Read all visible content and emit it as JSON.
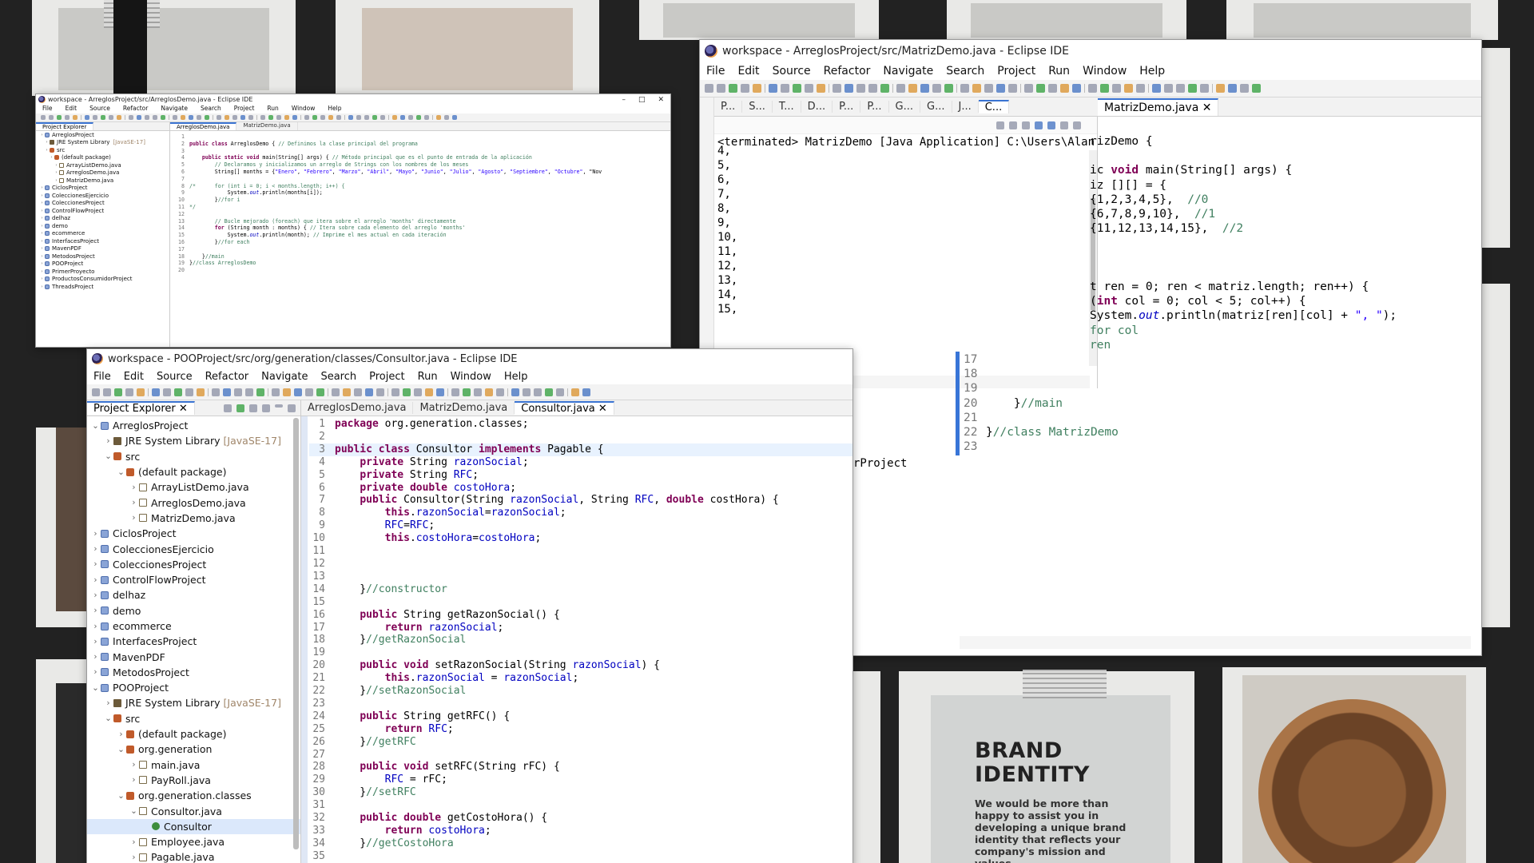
{
  "bg": {
    "brand_title_1": "BRAND",
    "brand_title_2": "IDENTITY",
    "brand_text": "We would be more than happy to assist you in developing a unique brand identity that reflects your company's mission and values."
  },
  "win_small": {
    "title": "workspace - ArreglosProject/src/ArreglosDemo.java - Eclipse IDE",
    "menu": [
      "File",
      "Edit",
      "Source",
      "Refactor",
      "Navigate",
      "Search",
      "Project",
      "Run",
      "Window",
      "Help"
    ],
    "explorer_tab": "Project Explorer",
    "editor_tabs": [
      "ArreglosDemo.java",
      "MatrizDemo.java"
    ],
    "tree": [
      {
        "label": "ArreglosProject",
        "level": 0,
        "icon": "proj"
      },
      {
        "label": "JRE System Library",
        "extra": "[JavaSE-17]",
        "level": 1,
        "icon": "lib"
      },
      {
        "label": "src",
        "level": 1,
        "icon": "pkg"
      },
      {
        "label": "(default package)",
        "level": 2,
        "icon": "pkg"
      },
      {
        "label": "ArrayListDemo.java",
        "level": 3,
        "icon": "java"
      },
      {
        "label": "ArreglosDemo.java",
        "level": 3,
        "icon": "java"
      },
      {
        "label": "MatrizDemo.java",
        "level": 3,
        "icon": "java"
      },
      {
        "label": "CiclosProject",
        "level": 0,
        "icon": "proj"
      },
      {
        "label": "ColeccionesEjercicio",
        "level": 0,
        "icon": "proj"
      },
      {
        "label": "ColeccionesProject",
        "level": 0,
        "icon": "proj"
      },
      {
        "label": "ControlFlowProject",
        "level": 0,
        "icon": "proj"
      },
      {
        "label": "delhaz",
        "level": 0,
        "icon": "proj"
      },
      {
        "label": "demo",
        "level": 0,
        "icon": "proj"
      },
      {
        "label": "ecommerce",
        "level": 0,
        "icon": "proj"
      },
      {
        "label": "InterfacesProject",
        "level": 0,
        "icon": "proj"
      },
      {
        "label": "MavenPDF",
        "level": 0,
        "icon": "proj"
      },
      {
        "label": "MetodosProject",
        "level": 0,
        "icon": "proj"
      },
      {
        "label": "POOProject",
        "level": 0,
        "icon": "proj"
      },
      {
        "label": "PrimerProyecto",
        "level": 0,
        "icon": "proj"
      },
      {
        "label": "ProductosConsumidorProject",
        "level": 0,
        "icon": "proj"
      },
      {
        "label": "ThreadsProject",
        "level": 0,
        "icon": "proj"
      }
    ],
    "code": [
      {
        "n": "1",
        "t": ""
      },
      {
        "n": "2",
        "t": "public class ArreglosDemo { // Definimos la clase principal del programa"
      },
      {
        "n": "3",
        "t": ""
      },
      {
        "n": "4",
        "t": "    public static void main(String[] args) { // Método principal que es el punto de entrada de la aplicación"
      },
      {
        "n": "5",
        "t": "        // Declaramos y inicializamos un arreglo de Strings con los nombres de los meses"
      },
      {
        "n": "6",
        "t": "        String[] months = {\"Enero\", \"Febrero\", \"Marzo\", \"Abril\", \"Mayo\", \"Junio\", \"Julio\", \"Agosto\", \"Septiembre\", \"Octubre\", \"Nov"
      },
      {
        "n": "7",
        "t": ""
      },
      {
        "n": "8",
        "t": "/*      for (int i = 0; i < months.length; i++) {"
      },
      {
        "n": "9",
        "t": "            System.out.println(months[i]);"
      },
      {
        "n": "10",
        "t": "        }//for i"
      },
      {
        "n": "11",
        "t": "*/"
      },
      {
        "n": "12",
        "t": ""
      },
      {
        "n": "13",
        "t": "        // Bucle mejorado (foreach) que itera sobre el arreglo 'months' directamente"
      },
      {
        "n": "14",
        "t": "        for (String month : months) { // Itera sobre cada elemento del arreglo 'months'"
      },
      {
        "n": "15",
        "t": "            System.out.println(month); // Imprime el mes actual en cada iteración"
      },
      {
        "n": "16",
        "t": "        }//for each"
      },
      {
        "n": "17",
        "t": ""
      },
      {
        "n": "18",
        "t": "    }//main"
      },
      {
        "n": "19",
        "t": "}//class ArreglosDemo"
      },
      {
        "n": "20",
        "t": ""
      }
    ]
  },
  "win_right": {
    "title": "workspace - ArreglosProject/src/MatrizDemo.java - Eclipse IDE",
    "menu": [
      "File",
      "Edit",
      "Source",
      "Refactor",
      "Navigate",
      "Search",
      "Project",
      "Run",
      "Window",
      "Help"
    ],
    "view_tabs": [
      "P...",
      "S...",
      "T...",
      "D...",
      "P...",
      "P...",
      "G...",
      "G...",
      "J...",
      "C..."
    ],
    "editor_tab": "MatrizDemo.java",
    "console_header": "<terminated> MatrizDemo [Java Application] C:\\Users\\Alan Trejo\\Downloac",
    "console_lines": [
      "4,",
      "5,",
      "6,",
      "7,",
      "8,",
      "9,",
      "10,",
      "11,",
      "12,",
      "13,",
      "14,",
      "15,"
    ],
    "code_top": [
      "rizDemo {",
      "",
      "ic void main(String[] args) {",
      "iz [][] = {",
      "{1,2,3,4,5},  //0",
      "{6,7,8,9,10},  //1",
      "{11,12,13,14,15},  //2",
      "",
      "",
      "",
      "t ren = 0; ren < matriz.length; ren++) {",
      "(int col = 0; col < 5; col++) {",
      "System.out.println(matriz[ren][col] + \", \");",
      "for col",
      "ren"
    ],
    "code_bottom": [
      {
        "n": "17",
        "t": ""
      },
      {
        "n": "18",
        "t": ""
      },
      {
        "n": "19",
        "t": ""
      },
      {
        "n": "20",
        "t": "    }//main"
      },
      {
        "n": "21",
        "t": ""
      },
      {
        "n": "22",
        "t": "}//class MatrizDemo"
      },
      {
        "n": "23",
        "t": ""
      }
    ],
    "peek_text": "rProject"
  },
  "win_main": {
    "title": "workspace - POOProject/src/org/generation/classes/Consultor.java - Eclipse IDE",
    "menu": [
      "File",
      "Edit",
      "Source",
      "Refactor",
      "Navigate",
      "Search",
      "Project",
      "Run",
      "Window",
      "Help"
    ],
    "explorer_tab": "Project Explorer",
    "editor_tabs": [
      "ArreglosDemo.java",
      "MatrizDemo.java",
      "Consultor.java"
    ],
    "tree": [
      {
        "label": "ArreglosProject",
        "level": 0,
        "icon": "proj",
        "open": true
      },
      {
        "label": "JRE System Library",
        "extra": "[JavaSE-17]",
        "level": 1,
        "icon": "lib"
      },
      {
        "label": "src",
        "level": 1,
        "icon": "pkg",
        "open": true
      },
      {
        "label": "(default package)",
        "level": 2,
        "icon": "pkg",
        "open": true
      },
      {
        "label": "ArrayListDemo.java",
        "level": 3,
        "icon": "java"
      },
      {
        "label": "ArreglosDemo.java",
        "level": 3,
        "icon": "java"
      },
      {
        "label": "MatrizDemo.java",
        "level": 3,
        "icon": "java"
      },
      {
        "label": "CiclosProject",
        "level": 0,
        "icon": "proj"
      },
      {
        "label": "ColeccionesEjercicio",
        "level": 0,
        "icon": "proj"
      },
      {
        "label": "ColeccionesProject",
        "level": 0,
        "icon": "proj"
      },
      {
        "label": "ControlFlowProject",
        "level": 0,
        "icon": "proj"
      },
      {
        "label": "delhaz",
        "level": 0,
        "icon": "proj"
      },
      {
        "label": "demo",
        "level": 0,
        "icon": "proj"
      },
      {
        "label": "ecommerce",
        "level": 0,
        "icon": "proj"
      },
      {
        "label": "InterfacesProject",
        "level": 0,
        "icon": "proj"
      },
      {
        "label": "MavenPDF",
        "level": 0,
        "icon": "proj"
      },
      {
        "label": "MetodosProject",
        "level": 0,
        "icon": "proj"
      },
      {
        "label": "POOProject",
        "level": 0,
        "icon": "proj",
        "open": true
      },
      {
        "label": "JRE System Library",
        "extra": "[JavaSE-17]",
        "level": 1,
        "icon": "lib"
      },
      {
        "label": "src",
        "level": 1,
        "icon": "pkg",
        "open": true
      },
      {
        "label": "(default package)",
        "level": 2,
        "icon": "pkg"
      },
      {
        "label": "org.generation",
        "level": 2,
        "icon": "pkg",
        "open": true
      },
      {
        "label": "main.java",
        "level": 3,
        "icon": "java"
      },
      {
        "label": "PayRoll.java",
        "level": 3,
        "icon": "java"
      },
      {
        "label": "org.generation.classes",
        "level": 2,
        "icon": "pkg",
        "open": true
      },
      {
        "label": "Consultor.java",
        "level": 3,
        "icon": "java",
        "open": true
      },
      {
        "label": "Consultor",
        "level": 4,
        "icon": "cls",
        "selected": true
      },
      {
        "label": "Employee.java",
        "level": 3,
        "icon": "java"
      },
      {
        "label": "Pagable.java",
        "level": 3,
        "icon": "java"
      }
    ],
    "code": [
      {
        "n": "1",
        "t": "package org.generation.classes;"
      },
      {
        "n": "2",
        "t": ""
      },
      {
        "n": "3",
        "t": "public class Consultor implements Pagable {",
        "hl": true
      },
      {
        "n": "4",
        "t": "    private String razonSocial;"
      },
      {
        "n": "5",
        "t": "    private String RFC;"
      },
      {
        "n": "6",
        "t": "    private double costoHora;"
      },
      {
        "n": "7",
        "t": "    public Consultor(String razonSocial, String RFC, double costHora) {"
      },
      {
        "n": "8",
        "t": "        this.razonSocial=razonSocial;"
      },
      {
        "n": "9",
        "t": "        RFC=RFC;"
      },
      {
        "n": "10",
        "t": "        this.costoHora=costoHora;"
      },
      {
        "n": "11",
        "t": ""
      },
      {
        "n": "12",
        "t": ""
      },
      {
        "n": "13",
        "t": ""
      },
      {
        "n": "14",
        "t": "    }//constructor"
      },
      {
        "n": "15",
        "t": ""
      },
      {
        "n": "16",
        "t": "    public String getRazonSocial() {"
      },
      {
        "n": "17",
        "t": "        return razonSocial;"
      },
      {
        "n": "18",
        "t": "    }//getRazonSocial"
      },
      {
        "n": "19",
        "t": ""
      },
      {
        "n": "20",
        "t": "    public void setRazonSocial(String razonSocial) {"
      },
      {
        "n": "21",
        "t": "        this.razonSocial = razonSocial;"
      },
      {
        "n": "22",
        "t": "    }//setRazonSocial"
      },
      {
        "n": "23",
        "t": ""
      },
      {
        "n": "24",
        "t": "    public String getRFC() {"
      },
      {
        "n": "25",
        "t": "        return RFC;"
      },
      {
        "n": "26",
        "t": "    }//getRFC"
      },
      {
        "n": "27",
        "t": ""
      },
      {
        "n": "28",
        "t": "    public void setRFC(String rFC) {"
      },
      {
        "n": "29",
        "t": "        RFC = rFC;"
      },
      {
        "n": "30",
        "t": "    }//setRFC"
      },
      {
        "n": "31",
        "t": ""
      },
      {
        "n": "32",
        "t": "    public double getCostoHora() {"
      },
      {
        "n": "33",
        "t": "        return costoHora;"
      },
      {
        "n": "34",
        "t": "    }//getCostoHora"
      },
      {
        "n": "35",
        "t": ""
      }
    ]
  }
}
